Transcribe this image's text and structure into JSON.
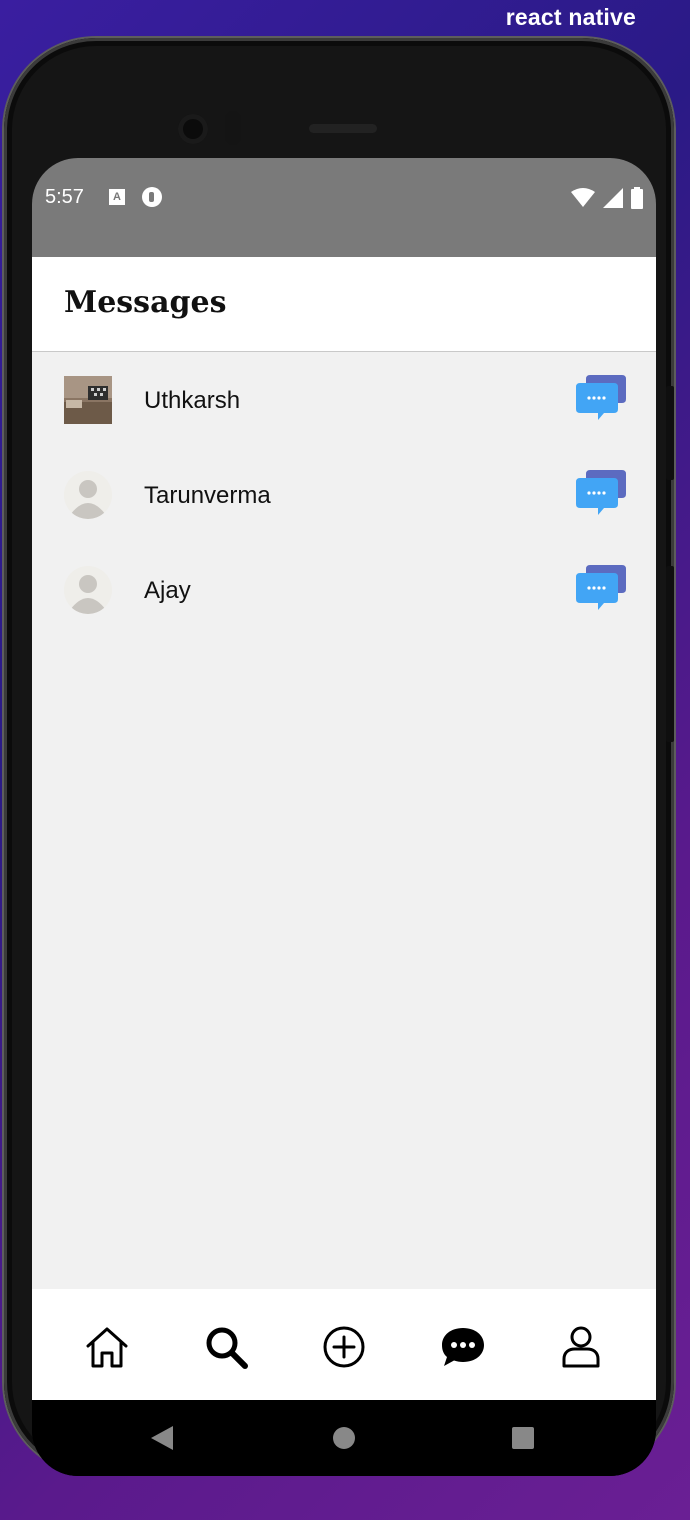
{
  "watermark": "react native",
  "status_bar": {
    "time": "5:57",
    "notification_icon_a": "A"
  },
  "header": {
    "title": "Messages"
  },
  "conversations": [
    {
      "name": "Uthkarsh",
      "avatar": "photo-avatar"
    },
    {
      "name": "Tarunverma",
      "avatar": "default-avatar"
    },
    {
      "name": "Ajay",
      "avatar": "default-avatar"
    }
  ],
  "bottom_nav": {
    "items": [
      {
        "icon": "home-icon"
      },
      {
        "icon": "search-icon"
      },
      {
        "icon": "add-icon"
      },
      {
        "icon": "chat-icon",
        "active": true
      },
      {
        "icon": "profile-icon"
      }
    ]
  },
  "colors": {
    "status_bar": "#7a7a7a",
    "content_bg": "#f1f1f1",
    "chat_blue": "#42a5f5",
    "chat_purple": "#5c6bc0"
  }
}
